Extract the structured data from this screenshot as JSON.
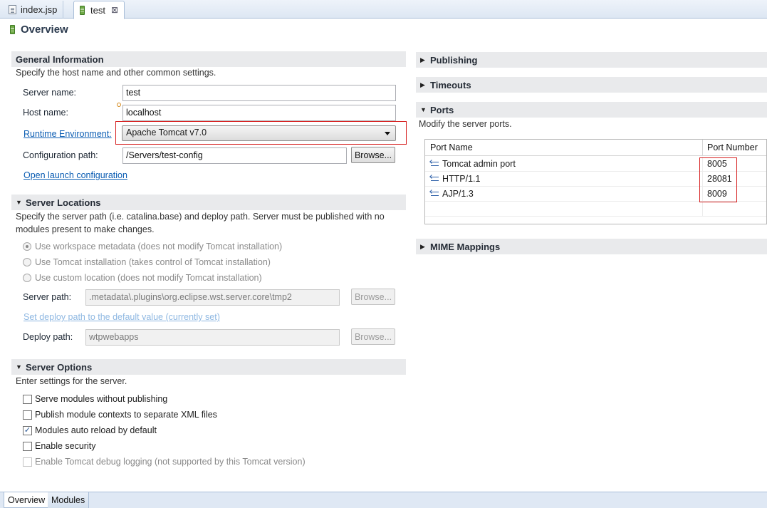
{
  "editor_tabs": [
    {
      "label": "index.jsp",
      "icon": "file-icon",
      "active": false
    },
    {
      "label": "test",
      "icon": "server-icon",
      "active": true,
      "close": "⊠"
    }
  ],
  "overview_title": "Overview",
  "general": {
    "title": "General Information",
    "description": "Specify the host name and other common settings.",
    "server_name_label": "Server name:",
    "server_name_value": "test",
    "host_name_label": "Host name:",
    "host_name_value": "localhost",
    "runtime_label": "Runtime Environment:",
    "runtime_value": "Apache Tomcat v7.0",
    "config_path_label": "Configuration path:",
    "config_path_value": "/Servers/test-config",
    "browse_label": "Browse...",
    "open_launch_label": "Open launch configuration"
  },
  "locations": {
    "title": "Server Locations",
    "description_line1": "Specify the server path (i.e. catalina.base) and deploy path. Server must be published with no",
    "description_line2": "modules present to make changes.",
    "radio1": "Use workspace metadata (does not modify Tomcat installation)",
    "radio2": "Use Tomcat installation (takes control of Tomcat installation)",
    "radio3": "Use custom location (does not modify Tomcat installation)",
    "server_path_label": "Server path:",
    "server_path_value": ".metadata\\.plugins\\org.eclipse.wst.server.core\\tmp2",
    "browse_label": "Browse...",
    "set_deploy_label": "Set deploy path to the default value (currently set)",
    "deploy_path_label": "Deploy path:",
    "deploy_path_value": "wtpwebapps"
  },
  "options": {
    "title": "Server Options",
    "description": "Enter settings for the server.",
    "items": [
      {
        "label": "Serve modules without publishing",
        "checked": false,
        "enabled": true
      },
      {
        "label": "Publish module contexts to separate XML files",
        "checked": false,
        "enabled": true
      },
      {
        "label": "Modules auto reload by default",
        "checked": true,
        "enabled": true
      },
      {
        "label": "Enable security",
        "checked": false,
        "enabled": true
      },
      {
        "label": "Enable Tomcat debug logging (not supported by this Tomcat version)",
        "checked": false,
        "enabled": false
      }
    ]
  },
  "right": {
    "publishing_title": "Publishing",
    "timeouts_title": "Timeouts",
    "ports_title": "Ports",
    "ports_description": "Modify the server ports.",
    "col_port_name": "Port Name",
    "col_port_number": "Port Number",
    "ports": [
      {
        "name": "Tomcat admin port",
        "number": "8005"
      },
      {
        "name": "HTTP/1.1",
        "number": "28081"
      },
      {
        "name": "AJP/1.3",
        "number": "8009"
      }
    ],
    "mime_title": "MIME Mappings"
  },
  "bottom_tabs": [
    {
      "label": "Overview",
      "active": true
    },
    {
      "label": "Modules",
      "active": false
    }
  ],
  "colors": {
    "accent_link": "#0b5db3",
    "highlight_box": "#d61f1f",
    "section_bg": "#e9eaec"
  }
}
